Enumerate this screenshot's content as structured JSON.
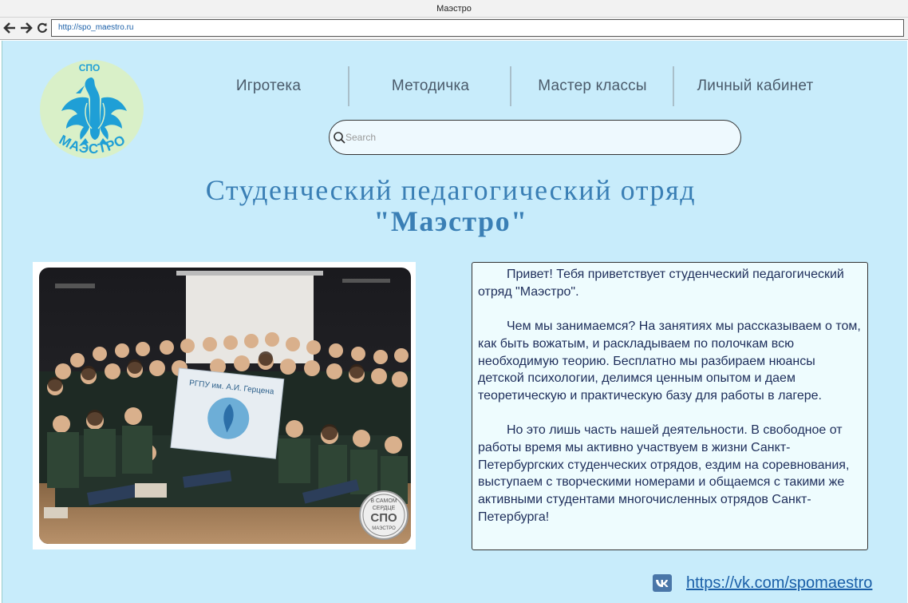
{
  "window": {
    "title": "Маэстро"
  },
  "browser": {
    "url": "http://spo_maestro.ru"
  },
  "logo": {
    "top_text": "СПО",
    "bottom_text": "МАЭСТРО"
  },
  "nav": {
    "items": [
      "Игротека",
      "Методичка",
      "Мастер классы",
      "Личный кабинет"
    ]
  },
  "search": {
    "placeholder": "Search",
    "value": ""
  },
  "heading": {
    "line1": "Студенческий педагогический отряд",
    "line2": "\"Маэстро\""
  },
  "photo": {
    "banner_text": "РГПУ им. А.И. Герцена",
    "stamp_lines": [
      "В САМОМ",
      "СЕРДЦЕ",
      "СПО",
      "МАЭСТРО"
    ]
  },
  "about": {
    "paragraphs": [
      "Привет! Тебя приветствует студенческий педагогический отряд \"Маэстро\".",
      "Чем мы занимаемся? На занятиях мы рассказываем о том, как быть вожатым, и раскладываем по полочкам всю необходимую теорию. Бесплатно мы разбираем нюансы детской психологии, делимся ценным опытом и даем теоретическую и практическую базу для работы в лагере.",
      "Но это лишь часть нашей деятельности. В свободное от работы время мы активно участвуем в жизни Санкт-Петербургских студенческих отрядов, ездим на соревнования, выступаем с творческими номерами и общаемся с такими же активными студентами многочисленных отрядов Санкт-Петербурга!"
    ]
  },
  "social": {
    "icon": "vk-icon",
    "link": "https://vk.com/spomaestro"
  },
  "colors": {
    "page_bg": "#c8ecfb",
    "heading": "#3a7fb5",
    "link": "#1a5fa8",
    "logo_bg": "#d9f0c8",
    "logo_blue": "#1f9fd6"
  }
}
